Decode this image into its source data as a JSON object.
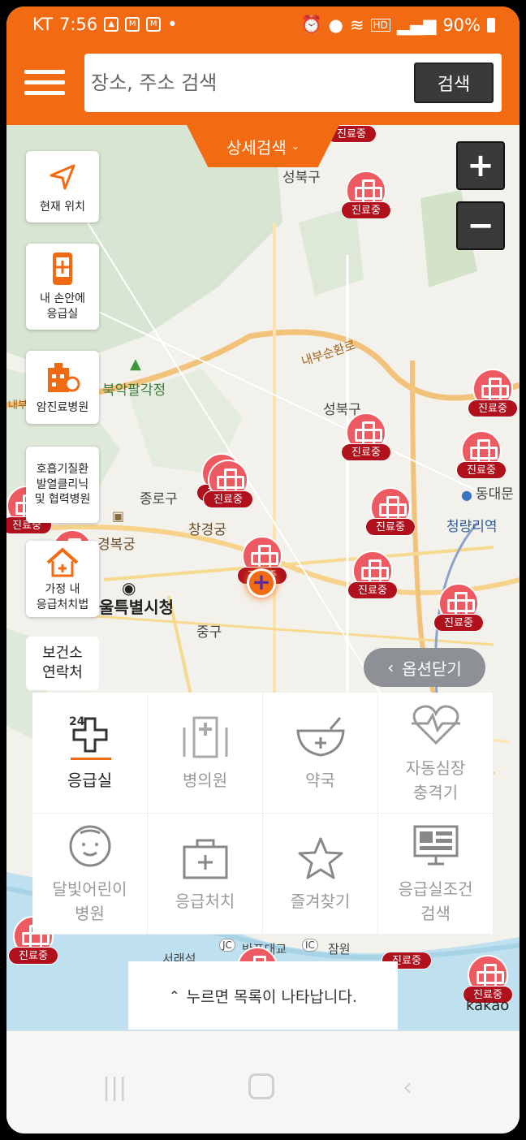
{
  "status_bar": {
    "carrier": "KT",
    "time": "7:56",
    "battery": "90%",
    "icons": [
      "image-icon",
      "m-badge-icon",
      "m-badge-icon",
      "dot-icon",
      "alarm-icon",
      "location-icon",
      "wifi-icon",
      "hd-icon",
      "signal-icon",
      "battery-icon"
    ]
  },
  "header": {
    "search_placeholder": "장소, 주소 검색",
    "search_button": "검색",
    "detail_search": "상세검색"
  },
  "side_buttons": {
    "current_location": "현재 위치",
    "emergency_in_hand": "내 손안에\n응급실",
    "cancer_hospital": "암진료병원",
    "respiratory_clinic": "호흡기질환\n발열클리닉\n및 협력병원",
    "home_first_aid": "가정 내\n응급처치법",
    "health_center": "보건소\n연락처"
  },
  "zoom": {
    "in": "+",
    "out": "−"
  },
  "map": {
    "marker_label": "진료중",
    "places": {
      "seongbuk_gu_top": "성북구",
      "seongbuk_gu": "성북구",
      "bugak": "북악팔각정",
      "jongno": "종로구",
      "changgyeong": "창경궁",
      "gyeongbok": "경복궁",
      "city_hall": "울특별시청",
      "junggu": "중구",
      "dongdaemun": "동대문",
      "cheongnyangni": "청량리역",
      "naebu_road": "내부순환로",
      "banpo": "반포대교",
      "jamwon": "잠원",
      "seorae": "서래섬",
      "jc": "JC",
      "ic": "IC",
      "naebu_left": "내부"
    },
    "attribution": "kakao"
  },
  "options_close": "옵션닫기",
  "categories": [
    {
      "label": "응급실",
      "icon": "emergency-room-24-icon",
      "active": true
    },
    {
      "label": "병의원",
      "icon": "hospital-icon",
      "active": false
    },
    {
      "label": "약국",
      "icon": "pharmacy-bowl-icon",
      "active": false
    },
    {
      "label": "자동심장\n충격기",
      "icon": "heart-pulse-icon",
      "active": false
    },
    {
      "label": "달빛어린이\n병원",
      "icon": "child-face-icon",
      "active": false
    },
    {
      "label": "응급처치",
      "icon": "first-aid-kit-icon",
      "active": false
    },
    {
      "label": "즐겨찾기",
      "icon": "star-icon",
      "active": false
    },
    {
      "label": "응급실조건\n검색",
      "icon": "monitor-icon",
      "active": false
    }
  ],
  "list_hint": "누르면 목록이 나타납니다.",
  "colors": {
    "brand_orange": "#F26A11",
    "marker_red": "#ee5a62",
    "marker_tag": "#b0111d",
    "dark_button": "#3a3a3a"
  }
}
